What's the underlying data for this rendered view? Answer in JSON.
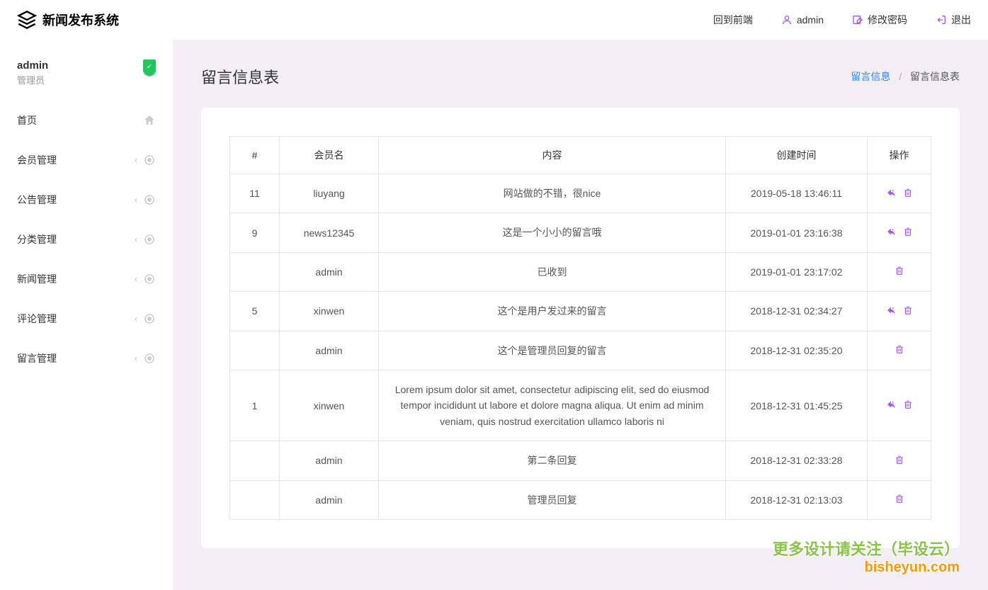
{
  "header": {
    "logo_text": "新闻发布系统",
    "nav": {
      "back_frontend": "回到前端",
      "admin": "admin",
      "change_password": "修改密码",
      "logout": "退出"
    }
  },
  "sidebar": {
    "user": {
      "name": "admin",
      "role": "管理员"
    },
    "items": [
      {
        "label": "首页",
        "has_chevron": false,
        "icon": "home"
      },
      {
        "label": "会员管理",
        "has_chevron": true,
        "icon": "target"
      },
      {
        "label": "公告管理",
        "has_chevron": true,
        "icon": "target"
      },
      {
        "label": "分类管理",
        "has_chevron": true,
        "icon": "target"
      },
      {
        "label": "新闻管理",
        "has_chevron": true,
        "icon": "target"
      },
      {
        "label": "评论管理",
        "has_chevron": true,
        "icon": "target"
      },
      {
        "label": "留言管理",
        "has_chevron": true,
        "icon": "target"
      }
    ]
  },
  "page": {
    "title": "留言信息表",
    "breadcrumb": {
      "link": "留言信息",
      "current": "留言信息表"
    }
  },
  "table": {
    "headers": {
      "id": "#",
      "member": "会员名",
      "content": "内容",
      "created": "创建时间",
      "actions": "操作"
    },
    "rows": [
      {
        "id": "11",
        "member": "liuyang",
        "content": "网站做的不错，很nice",
        "created": "2019-05-18 13:46:11",
        "reply": true,
        "delete": true
      },
      {
        "id": "9",
        "member": "news12345",
        "content": "这是一个小小的留言哦",
        "created": "2019-01-01 23:16:38",
        "reply": true,
        "delete": true
      },
      {
        "id": "",
        "member": "admin",
        "content": "已收到",
        "created": "2019-01-01 23:17:02",
        "reply": false,
        "delete": true
      },
      {
        "id": "5",
        "member": "xinwen",
        "content": "这个是用户发过来的留言",
        "created": "2018-12-31 02:34:27",
        "reply": true,
        "delete": true
      },
      {
        "id": "",
        "member": "admin",
        "content": "这个是管理员回复的留言",
        "created": "2018-12-31 02:35:20",
        "reply": false,
        "delete": true
      },
      {
        "id": "1",
        "member": "xinwen",
        "content": "Lorem ipsum dolor sit amet, consectetur adipiscing elit, sed do eiusmod tempor incididunt ut labore et dolore magna aliqua. Ut enim ad minim veniam, quis nostrud exercitation ullamco laboris ni",
        "created": "2018-12-31 01:45:25",
        "reply": true,
        "delete": true
      },
      {
        "id": "",
        "member": "admin",
        "content": "第二条回复",
        "created": "2018-12-31 02:33:28",
        "reply": false,
        "delete": true
      },
      {
        "id": "",
        "member": "admin",
        "content": "管理员回复",
        "created": "2018-12-31 02:13:03",
        "reply": false,
        "delete": true
      }
    ]
  },
  "watermark": {
    "line1": "更多设计请关注（毕设云）",
    "line2": "bisheyun.com"
  }
}
